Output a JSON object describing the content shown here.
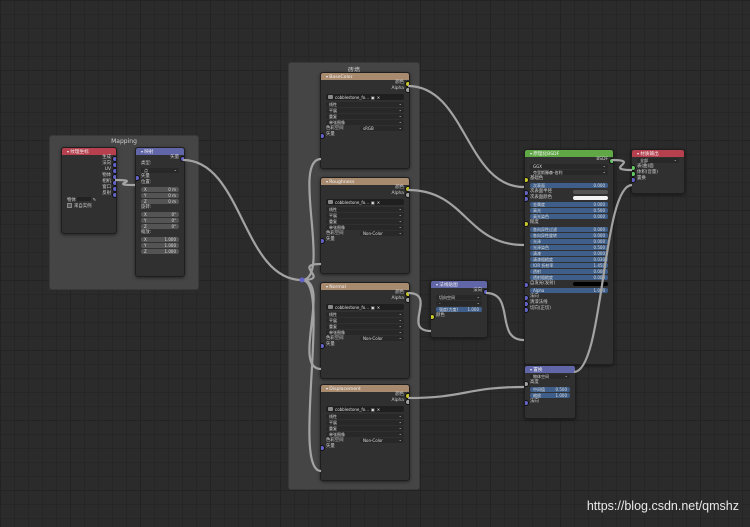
{
  "frame": {
    "title": "砖墙"
  },
  "mapping_frame": {
    "title": "Mapping"
  },
  "texcoord": {
    "title": "纹理坐标",
    "outputs": [
      "生成",
      "法向",
      "UV",
      "物体",
      "相机",
      "窗口",
      "反射"
    ],
    "object_label": "物体",
    "from_instancer": "来自实例"
  },
  "mapping": {
    "title": "映射",
    "output": "矢量",
    "type_label": "类型:",
    "type_value": "点",
    "input_vector": "矢量",
    "location_label": "位置:",
    "loc": [
      "X",
      "0 m",
      "Y",
      "0 m",
      "Z",
      "0 m"
    ],
    "rotation_label": "旋转:",
    "rot": [
      "X",
      "0°",
      "Y",
      "0°",
      "Z",
      "0°"
    ],
    "scale_label": "缩放:",
    "scl": [
      "X",
      "1.000",
      "Y",
      "1.000",
      "Z",
      "1.000"
    ]
  },
  "tex_common": {
    "image_name": "cobblestone_fo...",
    "interp": "线性",
    "proj": "平展",
    "ext": "重复",
    "src": "单张图像",
    "colorspace_label": "色彩空间",
    "out_color": "颜色",
    "out_alpha": "Alpha",
    "in_vector": "矢量"
  },
  "tex_nodes": [
    {
      "title": "BaseColor",
      "colorspace": "sRGB"
    },
    {
      "title": "Roughness",
      "colorspace": "Non-Color"
    },
    {
      "title": "Normal",
      "colorspace": "Non-Color"
    },
    {
      "title": "Displacement",
      "colorspace": "Non-Color"
    }
  ],
  "normal_map": {
    "title": "法线贴图",
    "output": "法向",
    "space": "切向空间",
    "uv": "-",
    "strength_label": "强度(力度)",
    "strength": "1.000",
    "color_in": "颜色"
  },
  "bsdf": {
    "title": "原理化BSDF",
    "output": "BSDF",
    "dist": "GGX",
    "sss": "克里斯滕森-伯利",
    "rows": [
      {
        "l": "基础色",
        "v": "",
        "t": "in"
      },
      {
        "l": "次表面",
        "v": "0.000",
        "t": "bar"
      },
      {
        "l": "次表面半径",
        "v": "",
        "t": "drop"
      },
      {
        "l": "次表面颜色",
        "v": "",
        "t": "white"
      },
      {
        "l": "金属度",
        "v": "0.000",
        "t": "bar"
      },
      {
        "l": "高光",
        "v": "0.500",
        "t": "bar"
      },
      {
        "l": "高光染色",
        "v": "0.000",
        "t": "bar"
      },
      {
        "l": "糙度",
        "v": "",
        "t": "in"
      },
      {
        "l": "各向异性过滤",
        "v": "0.000",
        "t": "bar"
      },
      {
        "l": "各向异性旋转",
        "v": "0.000",
        "t": "bar"
      },
      {
        "l": "光泽",
        "v": "0.000",
        "t": "bar"
      },
      {
        "l": "光泽染色",
        "v": "0.500",
        "t": "bar"
      },
      {
        "l": "清漆",
        "v": "0.000",
        "t": "bar"
      },
      {
        "l": "清漆粗糙度",
        "v": "0.030",
        "t": "bar"
      },
      {
        "l": "IOR 折射率",
        "v": "1.450",
        "t": "bar"
      },
      {
        "l": "透射",
        "v": "0.000",
        "t": "bar"
      },
      {
        "l": "透射粗糙度",
        "v": "0.000",
        "t": "bar"
      },
      {
        "l": "自发光(发射)",
        "v": "",
        "t": "black"
      },
      {
        "l": "Alpha",
        "v": "1.000",
        "t": "bar"
      },
      {
        "l": "法向",
        "v": "",
        "t": "in"
      },
      {
        "l": "清漆法线",
        "v": "",
        "t": "in"
      },
      {
        "l": "切向(正切)",
        "v": "",
        "t": "in"
      }
    ]
  },
  "output": {
    "title": "材质输出",
    "target": "全部",
    "inputs": [
      "表(曲)面",
      "体积(音量)",
      "置换"
    ]
  },
  "displacement": {
    "title": "置换",
    "space": "物体空间",
    "rows": [
      {
        "l": "高度",
        "v": ""
      },
      {
        "l": "中间值",
        "v": "0.500"
      },
      {
        "l": "缩放",
        "v": "1.000"
      },
      {
        "l": "法向",
        "v": ""
      }
    ]
  },
  "watermark": "https://blog.csdn.net/qmshz"
}
